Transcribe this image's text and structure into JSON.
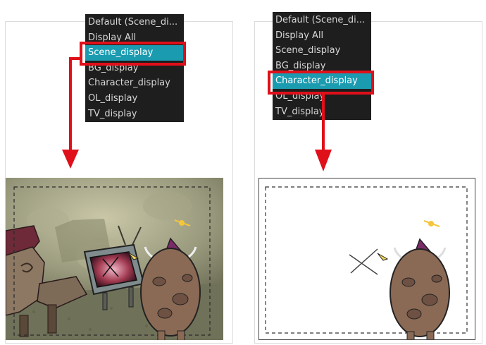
{
  "left_panel": {
    "menu": {
      "items": [
        "Default (Scene_di...",
        "Display All",
        "Scene_display",
        "BG_display",
        "Character_display",
        "OL_display",
        "TV_display"
      ],
      "selected_index": 2
    },
    "preview": {
      "mode": "scene"
    }
  },
  "right_panel": {
    "menu": {
      "items": [
        "Default (Scene_di...",
        "Display All",
        "Scene_display",
        "BG_display",
        "Character_display",
        "OL_display",
        "TV_display"
      ],
      "selected_index": 4
    },
    "preview": {
      "mode": "character-only"
    }
  },
  "colors": {
    "menu_bg": "#1e1e1e",
    "menu_text": "#d6d6d6",
    "selection": "#1b9bb0",
    "highlight_red": "#e0101a"
  }
}
